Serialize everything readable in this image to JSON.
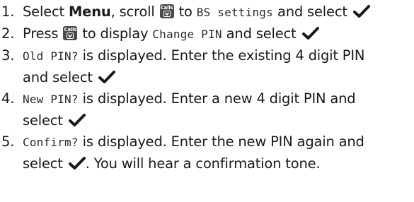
{
  "steps": [
    {
      "num": "1.",
      "parts": {
        "a": "Select ",
        "menu": "Menu",
        "b": ", scroll ",
        "c": " to ",
        "lcd": "BS settings",
        "d": " and select "
      }
    },
    {
      "num": "2.",
      "parts": {
        "a": "Press ",
        "b": " to display ",
        "lcd": "Change PIN",
        "c": " and select "
      }
    },
    {
      "num": "3.",
      "parts": {
        "lcd": "Old PIN?",
        "a": " is displayed. Enter the existing 4 digit PIN",
        "b": "and select "
      }
    },
    {
      "num": "4.",
      "parts": {
        "lcd": "New PIN?",
        "a": " is displayed. Enter a new 4 digit PIN and",
        "b": "select "
      }
    },
    {
      "num": "5.",
      "parts": {
        "lcd": "Confirm?",
        "a": " is displayed. Enter the new PIN again and",
        "b": "select ",
        "c": ". You will hear a confirmation tone."
      }
    }
  ],
  "icons": {
    "calls_key_label": "Calls",
    "calls_key_name": "calls-down-key-icon",
    "tick_name": "tick-icon"
  },
  "colors": {
    "text": "#1a1a1a",
    "key_bg": "#4a4a4a"
  }
}
